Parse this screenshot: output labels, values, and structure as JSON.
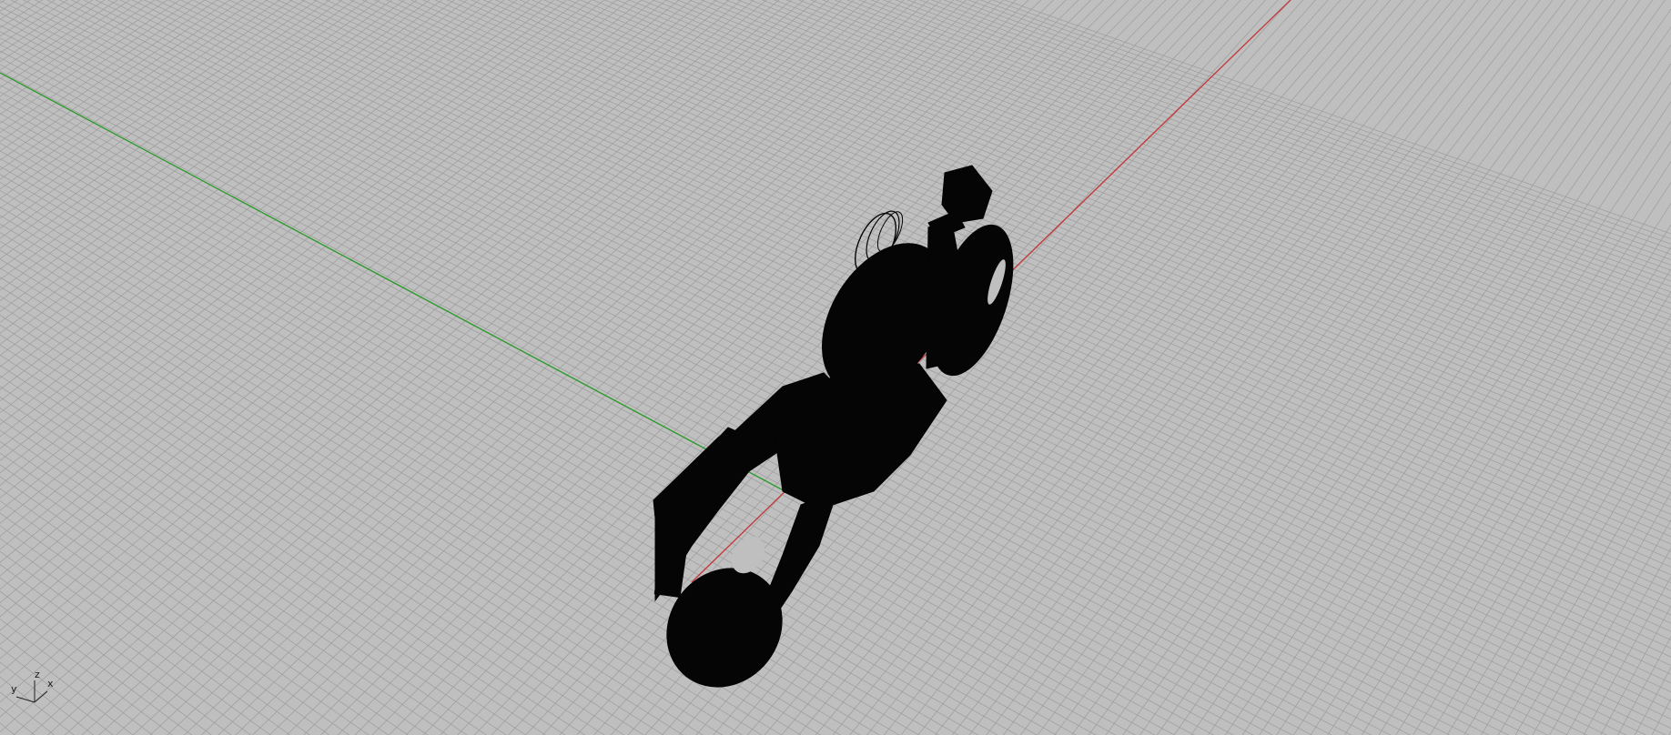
{
  "viewport": {
    "view": "perspective",
    "background_color": "#bfbfbf",
    "grid_color": "#9c9c9c",
    "x_axis_color": "#c23b3b",
    "y_axis_color": "#2f9a2f",
    "model_color": "#050505"
  },
  "axis_widget": {
    "x_label": "x",
    "y_label": "y",
    "z_label": "z"
  },
  "model": {
    "icon": "motorcycle-wireframe-icon"
  }
}
